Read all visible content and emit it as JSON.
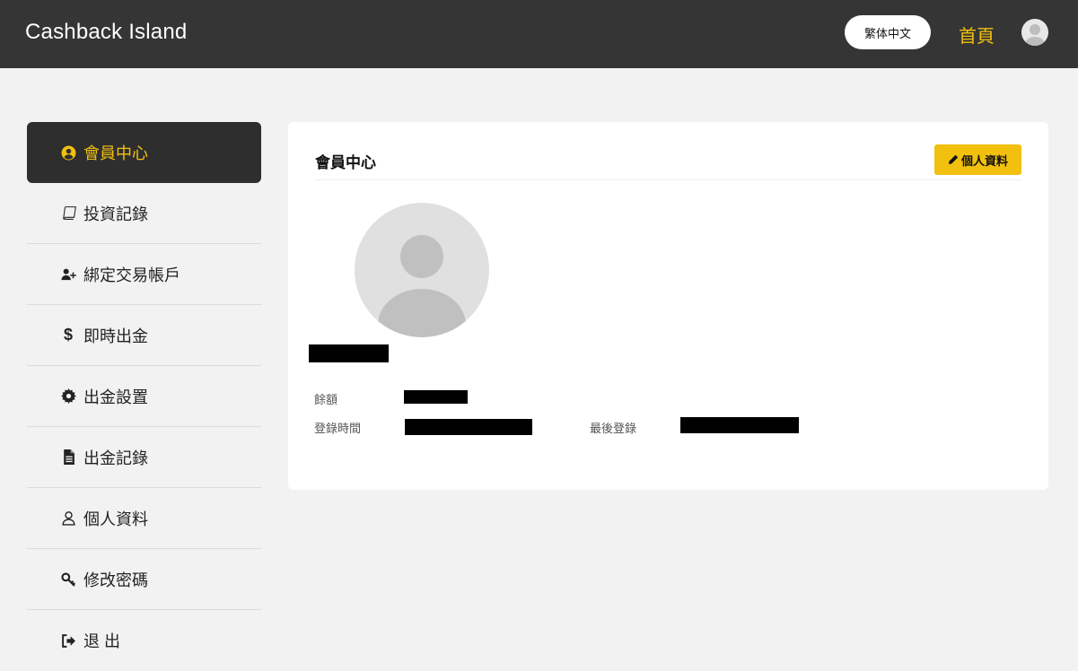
{
  "header": {
    "brand": "Cashback Island",
    "language_button": "繁体中文",
    "home_link": "首頁"
  },
  "sidebar": {
    "items": [
      {
        "label": "會員中心",
        "icon": "user-circle-icon",
        "active": true
      },
      {
        "label": "投資記錄",
        "icon": "book-icon"
      },
      {
        "label": "綁定交易帳戶",
        "icon": "user-plus-icon"
      },
      {
        "label": "即時出金",
        "icon": "dollar-icon"
      },
      {
        "label": "出金設置",
        "icon": "gear-icon"
      },
      {
        "label": "出金記錄",
        "icon": "file-icon"
      },
      {
        "label": "個人資料",
        "icon": "user-outline-icon"
      },
      {
        "label": "修改密碼",
        "icon": "key-icon"
      },
      {
        "label": "退 出",
        "icon": "sign-out-icon"
      }
    ]
  },
  "main": {
    "title": "會員中心",
    "profile_button": "個人資料",
    "fields": {
      "balance_label": "餘額",
      "register_time_label": "登錄時間",
      "last_login_label": "最後登錄"
    }
  },
  "colors": {
    "header_bg": "#353535",
    "accent": "#f2c00f",
    "active_sidebar_bg": "#2e2e2e",
    "page_bg": "#f2f2f2"
  }
}
